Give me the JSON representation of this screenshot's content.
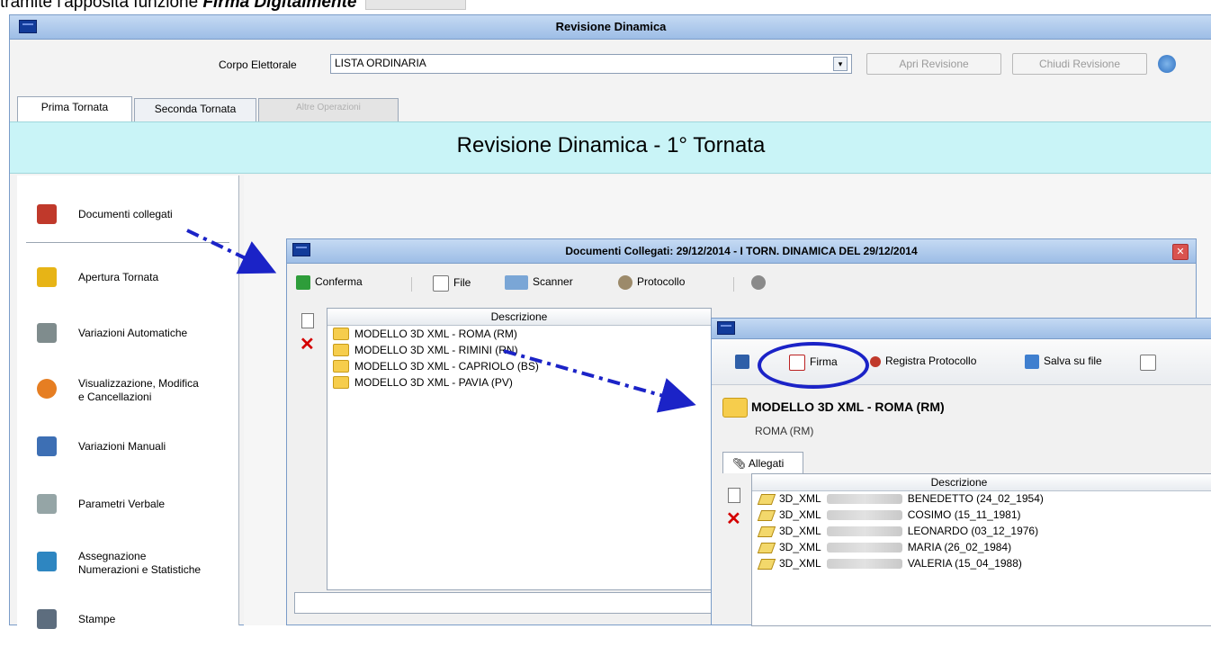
{
  "caption": {
    "prefix": "tramite l'apposita funzione",
    "bold": "Firma Digitalmente"
  },
  "main_window": {
    "title": "Revisione Dinamica",
    "corpo_label": "Corpo Elettorale",
    "corpo_value": "LISTA ORDINARIA",
    "apri_button": "Apri Revisione",
    "chiudi_button": "Chiudi Revisione",
    "tabs": [
      {
        "label": "Prima Tornata",
        "state": "active"
      },
      {
        "label": "Seconda Tornata",
        "state": "normal"
      },
      {
        "label": "Altre Operazioni",
        "state": "disabled"
      }
    ],
    "banner": "Revisione Dinamica - 1° Tornata"
  },
  "sidebar": {
    "items": [
      {
        "label": "Documenti collegati",
        "icon": "book-icon",
        "color": "#c0392b"
      },
      {
        "label": "Apertura Tornata",
        "icon": "lock-icon",
        "color": "#e7b416"
      },
      {
        "label": "Variazioni Automatiche",
        "icon": "tools-icon",
        "color": "#7f8c8d"
      },
      {
        "label": "Visualizzazione, Modifica\ne Cancellazioni",
        "icon": "recycle-icon",
        "color": "#e67e22"
      },
      {
        "label": "Variazioni Manuali",
        "icon": "edit-icon",
        "color": "#3d6fb4"
      },
      {
        "label": "Parametri Verbale",
        "icon": "wrench-icon",
        "color": "#95a5a6"
      },
      {
        "label": "Assegnazione\nNumerazioni e Statistiche",
        "icon": "calculator-icon",
        "color": "#2e86c1"
      },
      {
        "label": "Stampe",
        "icon": "printer-icon",
        "color": "#5d6d7e"
      }
    ]
  },
  "doc_window": {
    "title": "Documenti Collegati: 29/12/2014 - I TORN. DINAMICA DEL 29/12/2014",
    "toolbar": [
      "Conferma",
      "File",
      "Scanner",
      "Protocollo"
    ],
    "column_header": "Descrizione",
    "rows": [
      "MODELLO 3D XML - ROMA (RM)",
      "MODELLO 3D XML - RIMINI (RN)",
      "MODELLO 3D XML - CAPRIOLO (BS)",
      "MODELLO 3D XML - PAVIA (PV)"
    ]
  },
  "detail_window": {
    "toolbar": [
      "Firma",
      "Registra Protocollo",
      "Salva su file"
    ],
    "name": "MODELLO 3D XML - ROMA (RM)",
    "subtitle": "ROMA (RM)",
    "tab_label": "Allegati",
    "column_header": "Descrizione",
    "rows": [
      {
        "prefix": "3D_XML",
        "name": "BENEDETTO (24_02_1954)"
      },
      {
        "prefix": "3D_XML",
        "name": "COSIMO (15_11_1981)"
      },
      {
        "prefix": "3D_XML",
        "name": "LEONARDO (03_12_1976)"
      },
      {
        "prefix": "3D_XML",
        "name": "MARIA (26_02_1984)"
      },
      {
        "prefix": "3D_XML",
        "name": "VALERIA (15_04_1988)"
      }
    ]
  },
  "colors": {
    "titlebar": "#b3cdee",
    "banner": "#c9f4f7",
    "highlight_circle": "#1b23c7",
    "arrow": "#1b23c7"
  }
}
